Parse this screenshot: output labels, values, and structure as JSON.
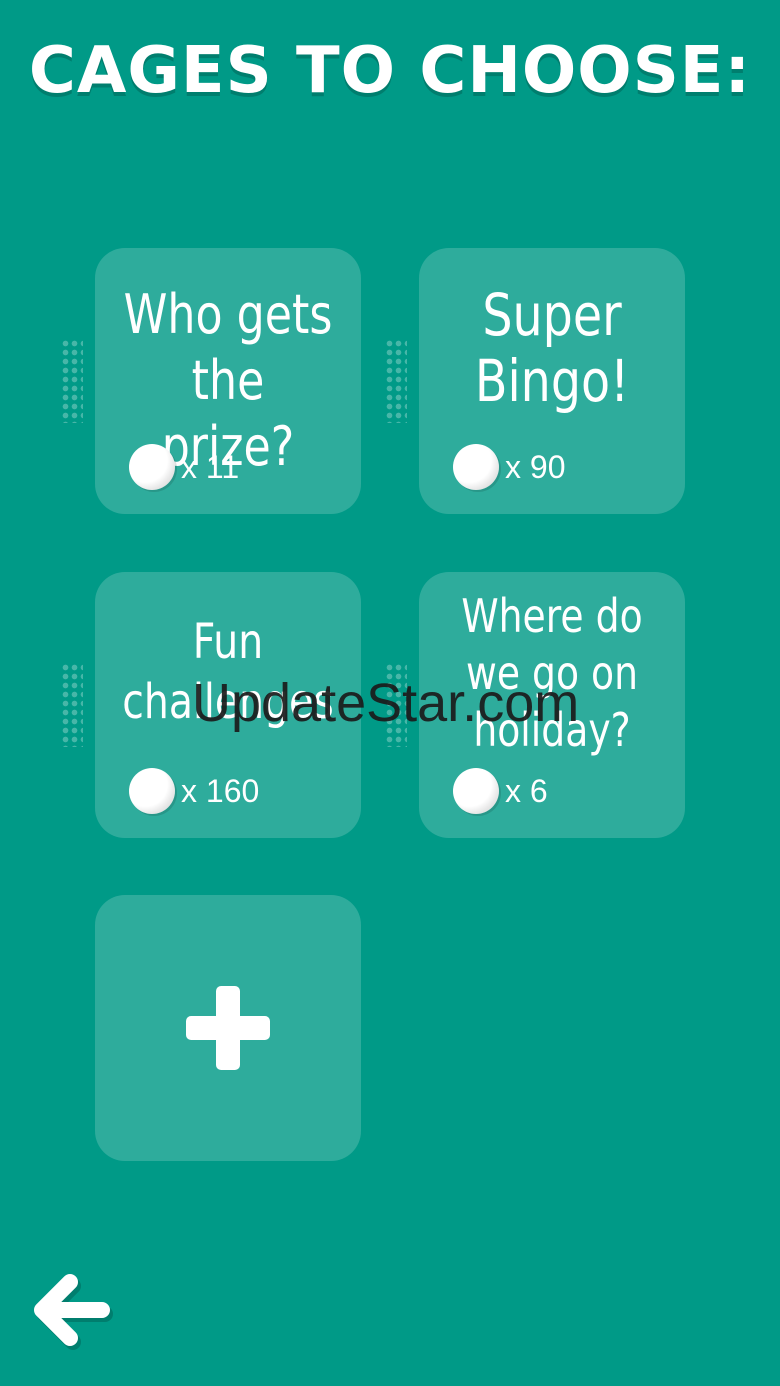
{
  "header": {
    "title": "CAGES TO CHOOSE:"
  },
  "cages": [
    {
      "title": "Who gets\nthe prize?",
      "count": "x 11"
    },
    {
      "title": "Super\nBingo!",
      "count": "x 90"
    },
    {
      "title": "Fun\nchallenges",
      "count": "x 160"
    },
    {
      "title": "Where do\nwe go on\nholiday?",
      "count": "x 6"
    }
  ],
  "add_card": {
    "icon": "plus-icon"
  },
  "footer": {
    "back_icon": "arrow-left-icon"
  },
  "watermark": {
    "text": "UpdateStar.com"
  },
  "colors": {
    "background": "#009a87",
    "card": "#33ad9e",
    "text": "#ffffff"
  }
}
